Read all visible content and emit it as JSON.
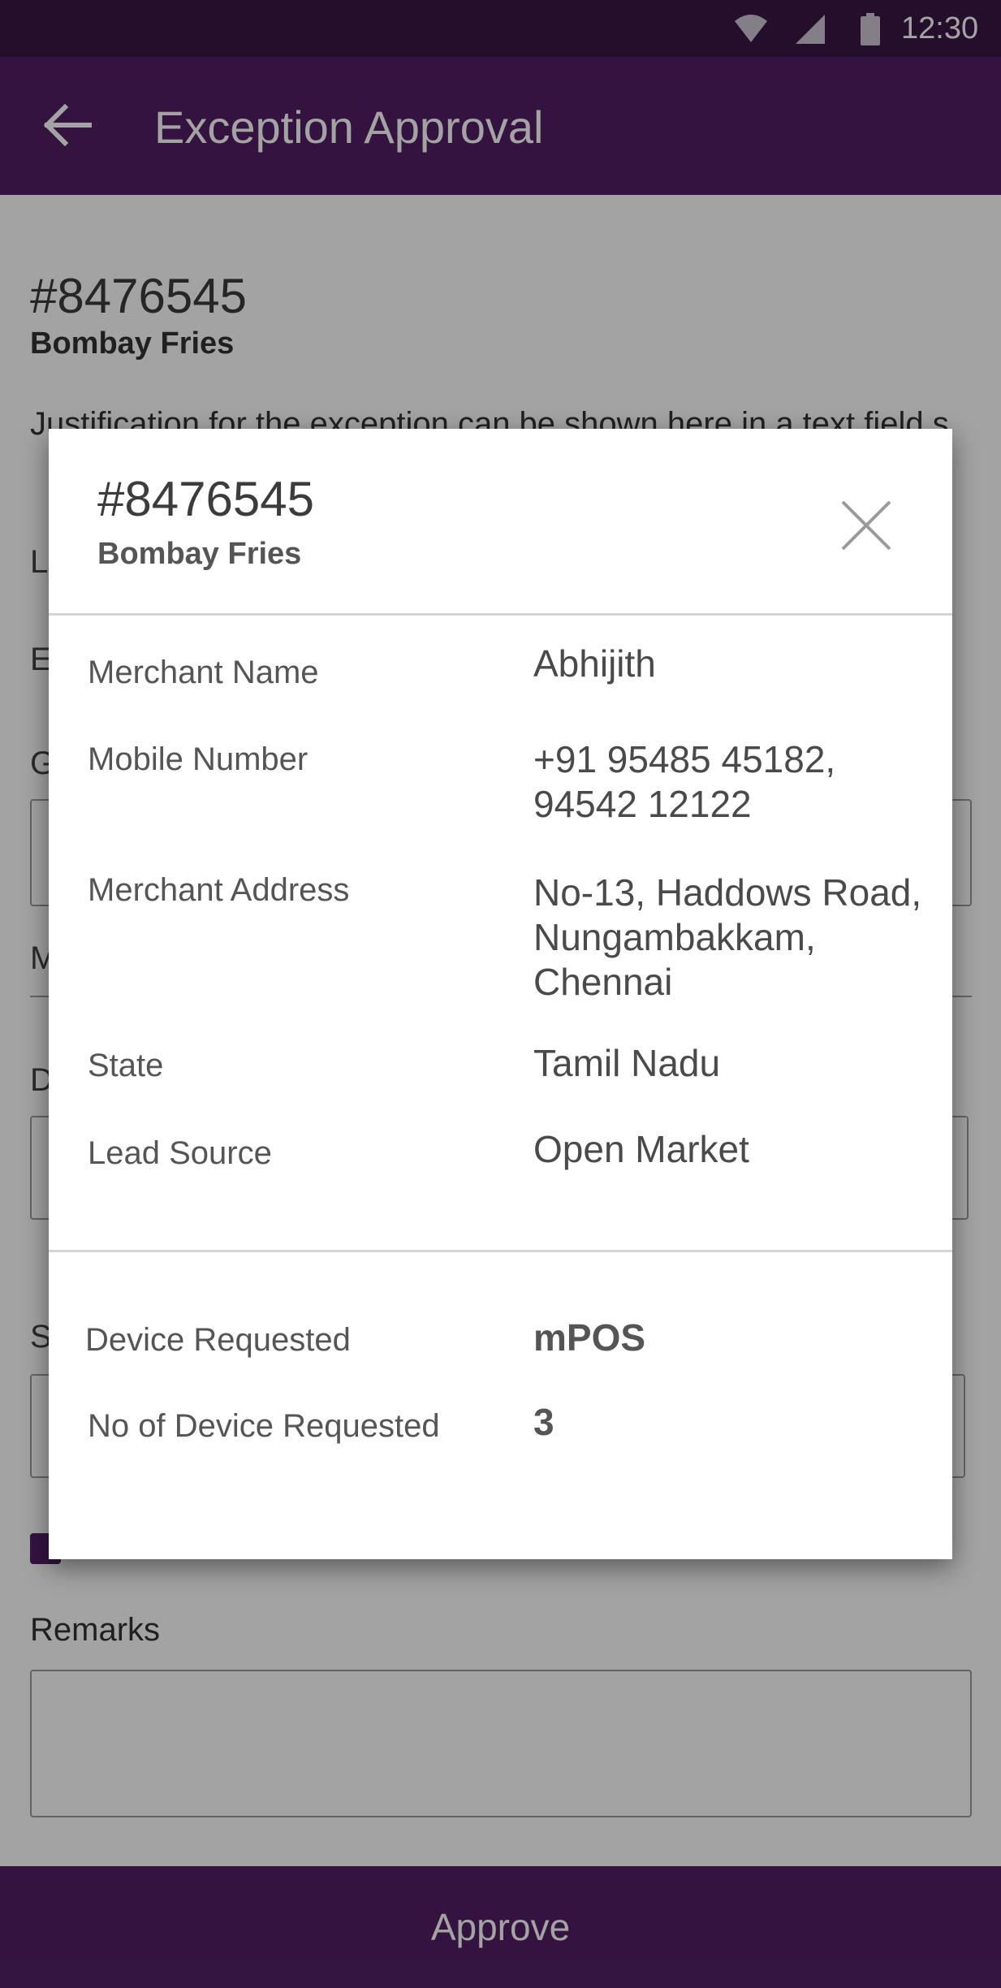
{
  "status_bar": {
    "time": "12:30"
  },
  "app_bar": {
    "title": "Exception Approval"
  },
  "background_page": {
    "order_id": "#8476545",
    "merchant": "Bombay Fries",
    "justification": "Justification for the exception can be shown here in a text field s",
    "partial_labels": [
      "L",
      "E",
      "G",
      "M",
      "D",
      "S"
    ],
    "remarks_label": "Remarks"
  },
  "dialog": {
    "order_id": "#8476545",
    "merchant": "Bombay Fries",
    "details": [
      {
        "label": "Merchant Name",
        "value": "Abhijith"
      },
      {
        "label": "Mobile Number",
        "value": "+91 95485 45182,\n94542 12122"
      },
      {
        "label": "Merchant Address",
        "value": "No-13, Haddows Road,\nNungambakkam,\nChennai"
      },
      {
        "label": "State",
        "value": "Tamil Nadu"
      },
      {
        "label": "Lead Source",
        "value": "Open Market"
      }
    ],
    "device": [
      {
        "label": "Device Requested",
        "value": "mPOS"
      },
      {
        "label": "No of Device Requested",
        "value": "3"
      }
    ]
  },
  "footer": {
    "approve_label": "Approve"
  },
  "colors": {
    "primary": "#521f64",
    "status_bar": "#3a1746"
  }
}
